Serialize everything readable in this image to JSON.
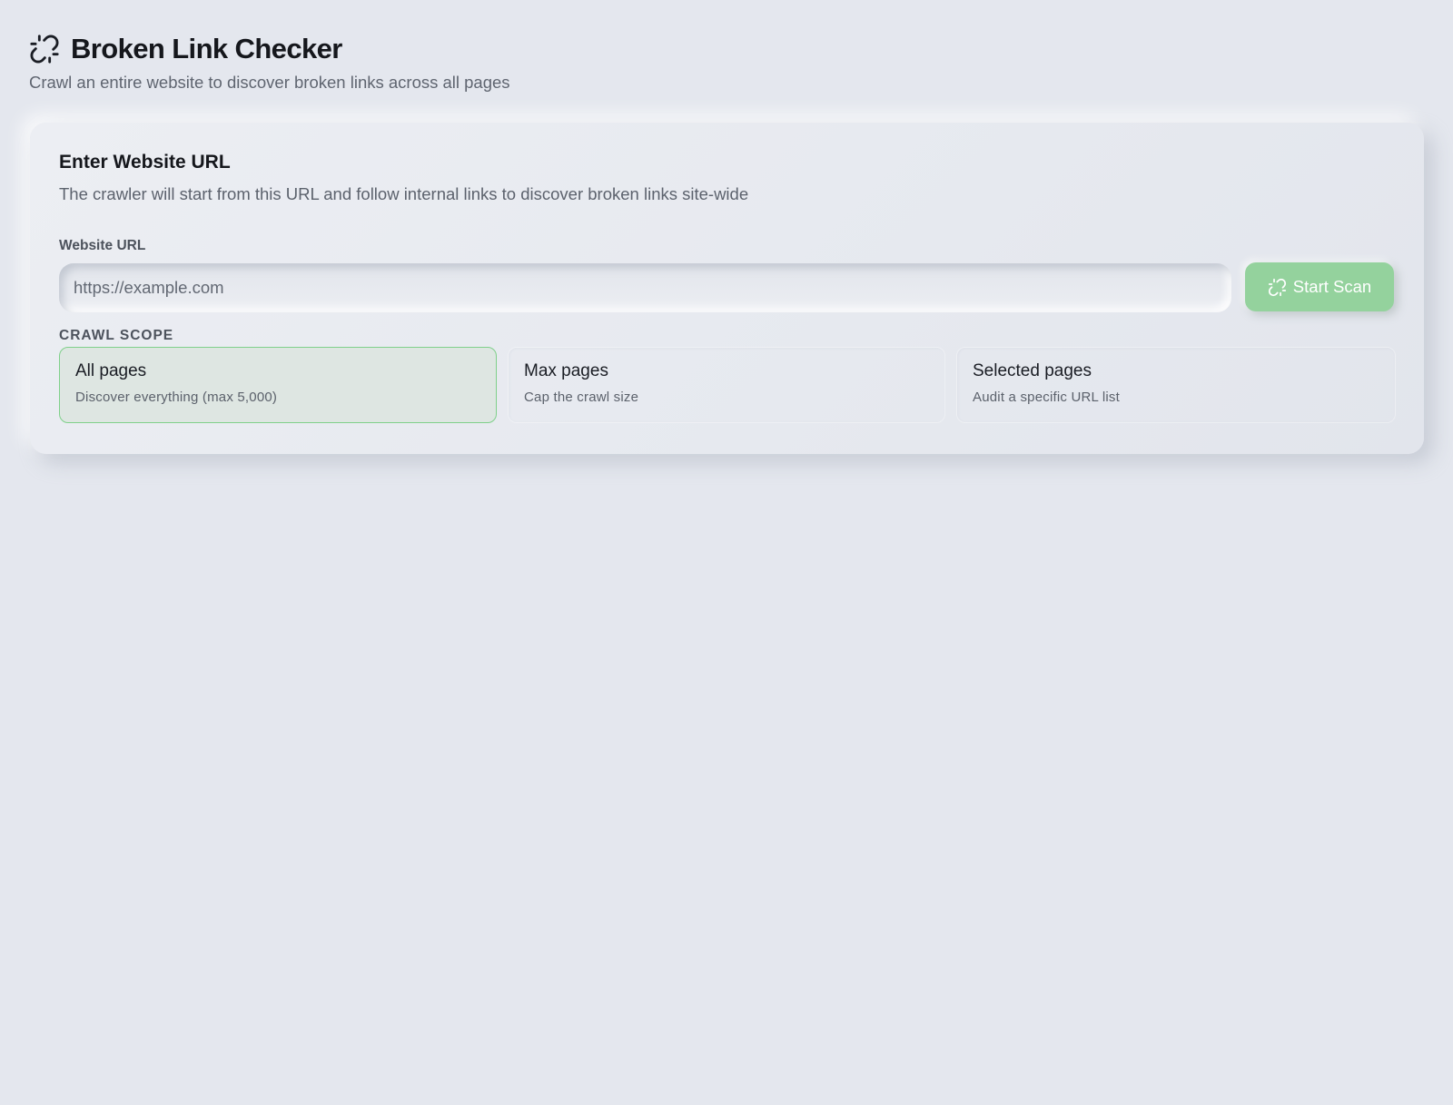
{
  "header": {
    "logo_icon": "broken-link-icon",
    "title": "Broken Link Checker",
    "subtitle": "Crawl an entire website to discover broken links across all pages"
  },
  "url_card": {
    "title": "Enter Website URL",
    "description": "The crawler will start from this URL and follow internal links to discover broken links site-wide",
    "field_label": "Website URL",
    "input_value": "",
    "input_placeholder": "https://example.com",
    "scan_button": {
      "label": "Start Scan",
      "icon": "broken-link-icon"
    }
  },
  "crawl_scope": {
    "label": "CRAWL SCOPE",
    "selected": "All pages",
    "options": [
      {
        "title": "All pages",
        "description": "Discover everything (max 5,000)"
      },
      {
        "title": "Max pages",
        "description": "Cap the crawl size"
      },
      {
        "title": "Selected pages",
        "description": "Audit a specific URL list"
      }
    ]
  },
  "colors": {
    "background": "#e4e7ee",
    "accent_green": "#94d29d",
    "selected_border": "#7fd08a",
    "text_primary": "#15171c",
    "text_muted": "#5f6570"
  }
}
